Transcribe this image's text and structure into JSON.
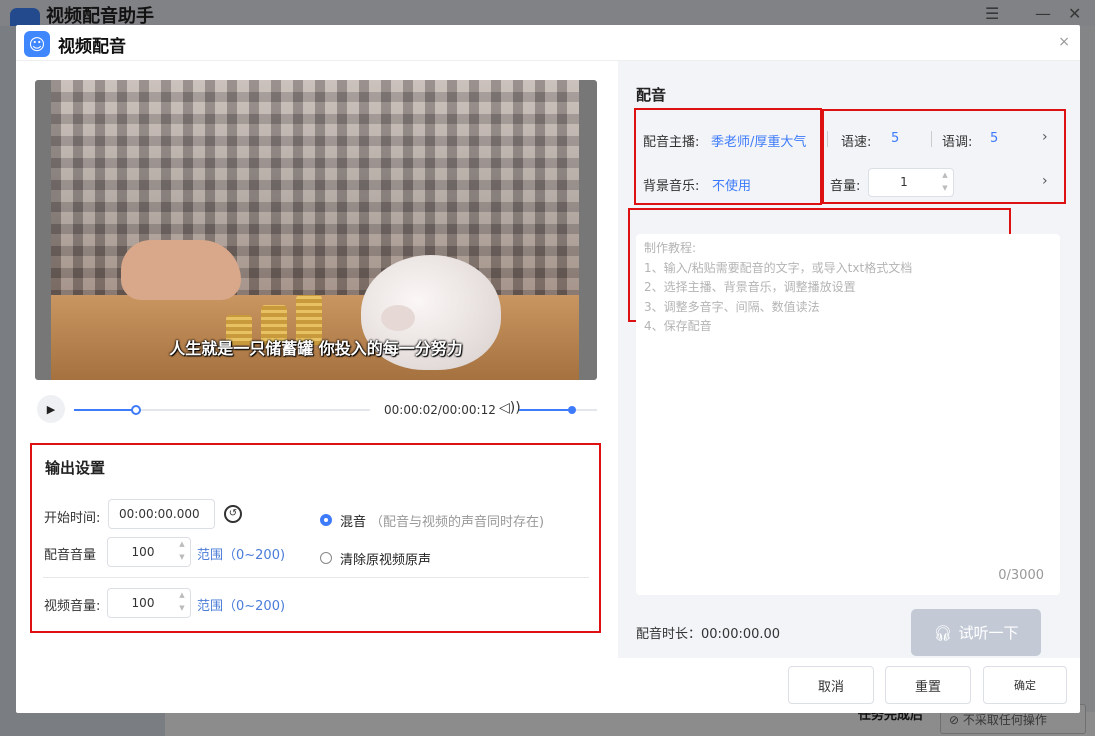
{
  "background_app": {
    "title": "视频配音助手",
    "bottom_label": "任务完成后",
    "bottom_select": "不采取任何操作"
  },
  "dialog": {
    "title": "视频配音",
    "close_label": "×"
  },
  "video": {
    "subtitle": "人生就是一只储蓄罐 你投入的每一分努力",
    "time": "00:00:02/00:00:12",
    "progress": 0.21,
    "volume": 0.68
  },
  "output_settings": {
    "title": "输出设置",
    "start_time_label": "开始时间:",
    "start_time_value": "00:00:00.000",
    "dub_volume_label": "配音音量",
    "dub_volume_value": "100",
    "video_volume_label": "视频音量:",
    "video_volume_value": "100",
    "range_text": "范围（0~200)",
    "mix_label": "混音",
    "mix_hint": "（配音与视频的声音同时存在)",
    "clear_label": "清除原视频原声",
    "selected_mode": "mix"
  },
  "dubbing": {
    "title": "配音",
    "anchor_label": "配音主播:",
    "anchor_value": "季老师/厚重大气",
    "speed_label": "语速:",
    "speed_value": "5",
    "pitch_label": "语调:",
    "pitch_value": "5",
    "bgm_label": "背景音乐:",
    "bgm_value": "不使用",
    "volume_label": "音量:",
    "volume_value": "1",
    "tutorial": [
      "制作教程:",
      "1、输入/粘贴需要配音的文字，或导入txt格式文档",
      "2、选择主播、背景音乐，调整播放设置",
      "3、调整多音字、间隔、数值读法",
      "4、保存配音"
    ],
    "char_count": "0/3000",
    "duration_label": "配音时长：00:00:00.00",
    "listen_label": "试听一下"
  },
  "footer": {
    "cancel": "取消",
    "reset": "重置",
    "confirm": "确定"
  },
  "colors": {
    "accent": "#3e7bfa",
    "highlight_box": "#dd1111"
  }
}
